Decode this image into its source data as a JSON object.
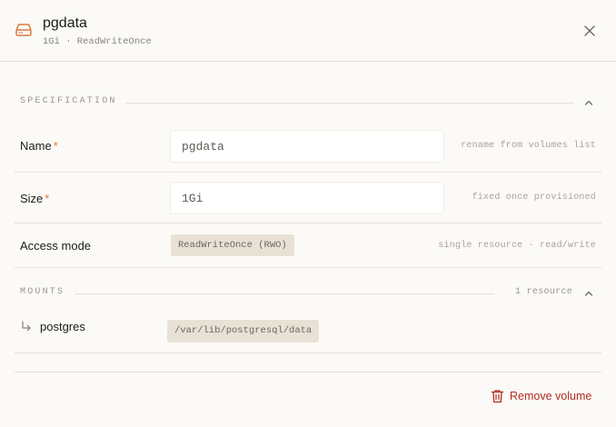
{
  "header": {
    "title": "pgdata",
    "subtitle": "1Gi · ReadWriteOnce",
    "icon": "hard-drive-icon",
    "icon_color": "#e0773f"
  },
  "specification": {
    "section_label": "SPECIFICATION",
    "name": {
      "label": "Name",
      "required_mark": "*",
      "value": "pgdata",
      "hint": "rename from volumes list"
    },
    "size": {
      "label": "Size",
      "required_mark": "*",
      "value": "1Gi",
      "hint": "fixed once provisioned"
    },
    "access_mode": {
      "label": "Access mode",
      "value": "ReadWriteOnce (RWO)",
      "hint": "single resource · read/write"
    }
  },
  "mounts": {
    "section_label": "MOUNTS",
    "count": "1 resource",
    "items": [
      {
        "resource": "postgres",
        "path": "/var/lib/postgresql/data"
      }
    ]
  },
  "footer": {
    "remove_label": "Remove volume",
    "danger_color": "#b52a22"
  }
}
